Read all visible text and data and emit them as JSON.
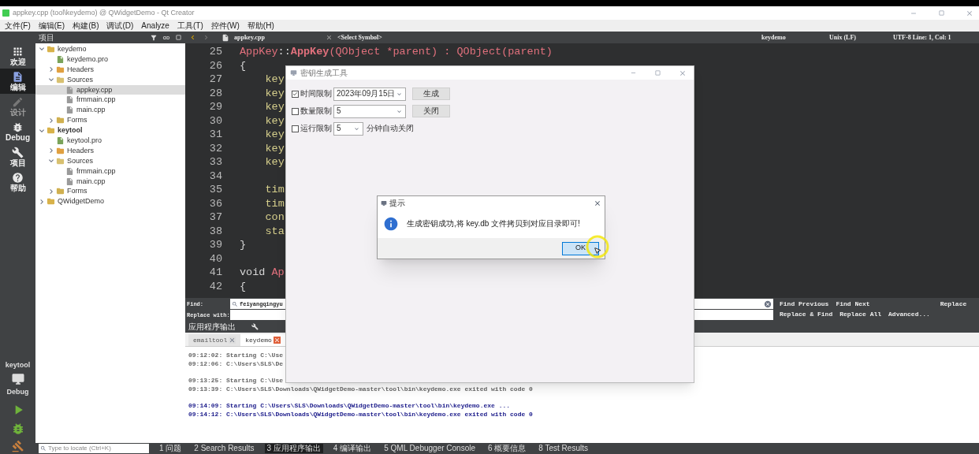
{
  "window": {
    "title": "appkey.cpp (tool\\keydemo) @ QWidgetDemo - Qt Creator"
  },
  "menu": [
    "文件(F)",
    "编辑(E)",
    "构建(B)",
    "调试(D)",
    "Analyze",
    "工具(T)",
    "控件(W)",
    "帮助(H)"
  ],
  "modes": [
    {
      "kind": "welcome",
      "label": "欢迎",
      "selected": false,
      "disabled": false
    },
    {
      "kind": "edit",
      "label": "编辑",
      "selected": true,
      "disabled": false
    },
    {
      "kind": "design",
      "label": "设计",
      "selected": false,
      "disabled": true
    },
    {
      "kind": "debug",
      "label": "Debug",
      "selected": false,
      "disabled": false
    },
    {
      "kind": "projects",
      "label": "项目",
      "selected": false,
      "disabled": false
    },
    {
      "kind": "help",
      "label": "帮助",
      "selected": false,
      "disabled": false
    }
  ],
  "kit": {
    "project": "keytool",
    "build": "Debug"
  },
  "project_panel": {
    "title": "项目",
    "tree": [
      {
        "kind": "project",
        "label": "keydemo",
        "active": false,
        "selected": false,
        "expanded": true,
        "children": [
          {
            "kind": "pro",
            "label": "keydemo.pro",
            "selected": false
          },
          {
            "kind": "headers",
            "label": "Headers",
            "selected": false,
            "expanded": false
          },
          {
            "kind": "sources",
            "label": "Sources",
            "selected": false,
            "expanded": true,
            "children": [
              {
                "kind": "file",
                "label": "appkey.cpp",
                "selected": true
              },
              {
                "kind": "file",
                "label": "frmmain.cpp",
                "selected": false
              },
              {
                "kind": "file",
                "label": "main.cpp",
                "selected": false
              }
            ]
          },
          {
            "kind": "forms",
            "label": "Forms",
            "selected": false,
            "expanded": false
          }
        ]
      },
      {
        "kind": "project",
        "label": "keytool",
        "active": true,
        "selected": false,
        "expanded": true,
        "children": [
          {
            "kind": "pro",
            "label": "keytool.pro",
            "selected": false
          },
          {
            "kind": "headers",
            "label": "Headers",
            "selected": false,
            "expanded": false
          },
          {
            "kind": "sources",
            "label": "Sources",
            "selected": false,
            "expanded": true,
            "children": [
              {
                "kind": "file",
                "label": "frmmain.cpp",
                "selected": false
              },
              {
                "kind": "file",
                "label": "main.cpp",
                "selected": false
              }
            ]
          },
          {
            "kind": "forms",
            "label": "Forms",
            "selected": false,
            "expanded": false
          }
        ]
      },
      {
        "kind": "project",
        "label": "QWidgetDemo",
        "active": false,
        "selected": false,
        "expanded": false
      }
    ]
  },
  "editor": {
    "file": "appkey.cpp",
    "symbol": "<Select Symbol>",
    "project": "keydemo",
    "line_endings": "Unix (LF)",
    "position": "UTF-8 Line: 1, Col: 1",
    "lines": [
      {
        "number": "25",
        "kind": "top",
        "tokens": [
          {
            "text": "AppKey",
            "kind": "type"
          },
          {
            "text": "::",
            "kind": "plain"
          },
          {
            "text": "AppKey",
            "kind": "function"
          },
          {
            "text": "(QObject *parent) : QObject(parent)",
            "kind": "type"
          }
        ]
      },
      {
        "number": "26",
        "kind": "top",
        "tokens": [
          {
            "text": "{",
            "kind": "plain"
          }
        ]
      },
      {
        "number": "27",
        "kind": "indented",
        "tokens": [
          {
            "text": "key",
            "kind": "member"
          }
        ]
      },
      {
        "number": "28",
        "kind": "indented",
        "tokens": [
          {
            "text": "key",
            "kind": "member"
          }
        ]
      },
      {
        "number": "29",
        "kind": "indented",
        "tokens": [
          {
            "text": "key",
            "kind": "member"
          }
        ]
      },
      {
        "number": "30",
        "kind": "indented",
        "tokens": [
          {
            "text": "key",
            "kind": "member"
          }
        ]
      },
      {
        "number": "31",
        "kind": "indented",
        "tokens": [
          {
            "text": "key",
            "kind": "member"
          }
        ]
      },
      {
        "number": "32",
        "kind": "indented",
        "tokens": [
          {
            "text": "key",
            "kind": "member"
          }
        ]
      },
      {
        "number": "33",
        "kind": "indented",
        "tokens": [
          {
            "text": "key",
            "kind": "member"
          }
        ]
      },
      {
        "number": "34",
        "kind": "blank"
      },
      {
        "number": "35",
        "kind": "indented",
        "tokens": [
          {
            "text": "tim",
            "kind": "member"
          }
        ]
      },
      {
        "number": "36",
        "kind": "indented",
        "tokens": [
          {
            "text": "tim",
            "kind": "member"
          }
        ]
      },
      {
        "number": "37",
        "kind": "indented",
        "tokens": [
          {
            "text": "con",
            "kind": "member"
          }
        ]
      },
      {
        "number": "38",
        "kind": "indented",
        "tokens": [
          {
            "text": "sta",
            "kind": "member"
          }
        ]
      },
      {
        "number": "39",
        "kind": "top",
        "tokens": [
          {
            "text": "}",
            "kind": "plain"
          }
        ]
      },
      {
        "number": "40",
        "kind": "blank"
      },
      {
        "number": "41",
        "kind": "top",
        "tokens": [
          {
            "text": "void ",
            "kind": "plain"
          },
          {
            "text": "Ap",
            "kind": "type"
          }
        ]
      },
      {
        "number": "42",
        "kind": "top",
        "tokens": [
          {
            "text": "{",
            "kind": "plain"
          }
        ]
      }
    ]
  },
  "find": {
    "find_label": "Find:",
    "find_value": "feiyangqingyu",
    "replace_label": "Replace with:",
    "buttons": [
      "Find Previous",
      "Find Next",
      "Replace",
      "Replace & Find",
      "Replace All",
      "Advanced..."
    ]
  },
  "output": {
    "title": "应用程序输出",
    "tabs": [
      {
        "label": "emailtool",
        "selected": false
      },
      {
        "label": "keydemo",
        "selected": true
      }
    ],
    "runs": [
      [
        {
          "text": "09:12:02: Starting C:\\Use",
          "kind": "previous"
        },
        {
          "text": "09:12:06: C:\\Users\\SLS\\De",
          "kind": "previous"
        }
      ],
      [
        {
          "text": "09:13:25: Starting C:\\Use",
          "kind": "previous"
        },
        {
          "text": "09:13:39: C:\\Users\\SLS\\Downloads\\QWidgetDemo-master\\tool\\bin\\keydemo.exe exited with code 0",
          "kind": "previous"
        }
      ],
      [
        {
          "text": "09:14:09: Starting C:\\Users\\SLS\\Downloads\\QWidgetDemo-master\\tool\\bin\\keydemo.exe ...",
          "kind": "latest"
        },
        {
          "text": "09:14:12: C:\\Users\\SLS\\Downloads\\QWidgetDemo-master\\tool\\bin\\keydemo.exe exited with code 0",
          "kind": "latest"
        }
      ]
    ]
  },
  "status_bar": {
    "locator_placeholder": "Type to locate (Ctrl+K)",
    "panes": [
      {
        "label": "1 问题",
        "selected": false
      },
      {
        "label": "2 Search Results",
        "selected": false
      },
      {
        "label": "3 应用程序输出",
        "selected": true
      },
      {
        "label": "4 编译输出",
        "selected": false
      },
      {
        "label": "5 QML Debugger Console",
        "selected": false
      },
      {
        "label": "6 概要信息",
        "selected": false
      },
      {
        "label": "8 Test Results",
        "selected": false
      }
    ]
  },
  "app_dialog": {
    "title": "密钥生成工具",
    "rows": [
      {
        "label": "时间限制",
        "checked": true,
        "value": "2023年09月15日",
        "button": "生成"
      },
      {
        "label": "数量限制",
        "checked": false,
        "value": "5",
        "button": "关闭"
      },
      {
        "label": "运行限制",
        "checked": false,
        "value": "5",
        "suffix": "分钟自动关闭"
      }
    ]
  },
  "message_box": {
    "title": "提示",
    "text": "生成密钥成功,将 key.db 文件拷贝到对应目录即可!",
    "button": "OK"
  }
}
